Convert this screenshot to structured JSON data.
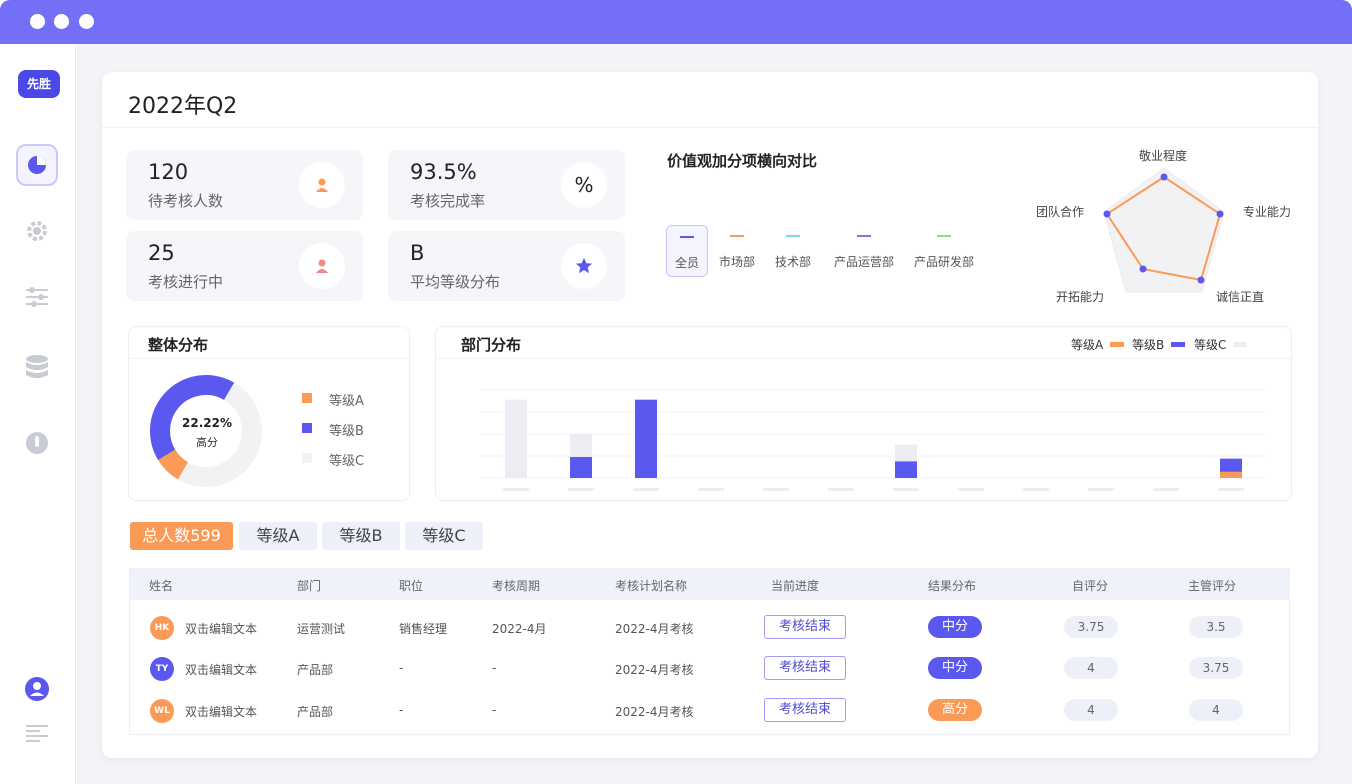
{
  "colors": {
    "titlebar": "#7370f7",
    "accent": "#5b58f0",
    "orange": "#fb9a57",
    "gradeC": "#f2f2f5"
  },
  "logo": "先胜",
  "sidebar": {
    "icons": [
      "dashboard-icon",
      "gear-icon",
      "sliders-icon",
      "database-icon",
      "gauge-icon",
      "user-icon",
      "menu-lines-icon"
    ]
  },
  "page_title": "2022年Q2",
  "stats": [
    {
      "value": "120",
      "label": "待考核人数",
      "icon": "person-icon"
    },
    {
      "value": "93.5%",
      "label": "考核完成率",
      "icon": "%"
    },
    {
      "value": "25",
      "label": "考核进行中",
      "icon": "person-icon"
    },
    {
      "value": "B",
      "label": "平均等级分布",
      "icon": "star-icon"
    }
  ],
  "radar": {
    "title": "价值观加分项横向对比",
    "filters": [
      {
        "label": "全员",
        "color": "#5b58f0"
      },
      {
        "label": "市场部",
        "color": "#fb9a57"
      },
      {
        "label": "技术部",
        "color": "#7fdbd0"
      },
      {
        "label": "产品运营部",
        "color": "#8a6cf0"
      },
      {
        "label": "产品研发部",
        "color": "#8fd88f"
      }
    ],
    "axes": [
      "敬业程度",
      "专业能力",
      "诚信正直",
      "开拓能力",
      "团队合作"
    ]
  },
  "overall": {
    "title": "整体分布",
    "center_value": "22.22%",
    "center_label": "高分",
    "legend": [
      "等级A",
      "等级B",
      "等级C"
    ]
  },
  "dept": {
    "title": "部门分布",
    "legend": [
      "等级A",
      "等级B",
      "等级C"
    ]
  },
  "chart_data": [
    {
      "type": "pie",
      "title": "整体分布",
      "labels": [
        "等级A",
        "等级B",
        "等级C"
      ],
      "values": [
        8,
        42,
        50
      ]
    },
    {
      "type": "bar",
      "title": "部门分布",
      "categories": [
        "",
        "",
        "",
        "",
        "",
        "",
        "",
        "",
        "",
        "",
        "",
        ""
      ],
      "series": [
        {
          "name": "等级A",
          "values": [
            0,
            0,
            0,
            0,
            0,
            0,
            0,
            0,
            0,
            0,
            0,
            7
          ]
        },
        {
          "name": "等级B",
          "values": [
            0,
            24,
            89,
            0,
            0,
            0,
            19,
            0,
            0,
            0,
            0,
            15
          ]
        },
        {
          "name": "等级C",
          "values": [
            89,
            26,
            0,
            0,
            0,
            0,
            19,
            0,
            0,
            0,
            0,
            0
          ]
        }
      ],
      "ylim": [
        0,
        100
      ]
    }
  ],
  "tabs": [
    "总人数599",
    "等级A",
    "等级B",
    "等级C"
  ],
  "table": {
    "headers": [
      "姓名",
      "部门",
      "职位",
      "考核周期",
      "考核计划名称",
      "当前进度",
      "结果分布",
      "自评分",
      "主管评分"
    ],
    "rows": [
      {
        "initials": "HK",
        "avatar_color": "#fb9a57",
        "name": "双击编辑文本",
        "dept": "运营测试",
        "position": "销售经理",
        "period": "2022-4月",
        "plan": "2022-4月考核",
        "progress": "考核结束",
        "result": "中分",
        "result_color": "#5b58f0",
        "self": "3.75",
        "manager": "3.5"
      },
      {
        "initials": "TY",
        "avatar_color": "#5b58f0",
        "name": "双击编辑文本",
        "dept": "产品部",
        "position": "-",
        "period": "-",
        "plan": "2022-4月考核",
        "progress": "考核结束",
        "result": "中分",
        "result_color": "#5b58f0",
        "self": "4",
        "manager": "3.75"
      },
      {
        "initials": "WL",
        "avatar_color": "#fb9a57",
        "name": "双击编辑文本",
        "dept": "产品部",
        "position": "-",
        "period": "-",
        "plan": "2022-4月考核",
        "progress": "考核结束",
        "result": "高分",
        "result_color": "#fb9a57",
        "self": "4",
        "manager": "4"
      }
    ]
  }
}
